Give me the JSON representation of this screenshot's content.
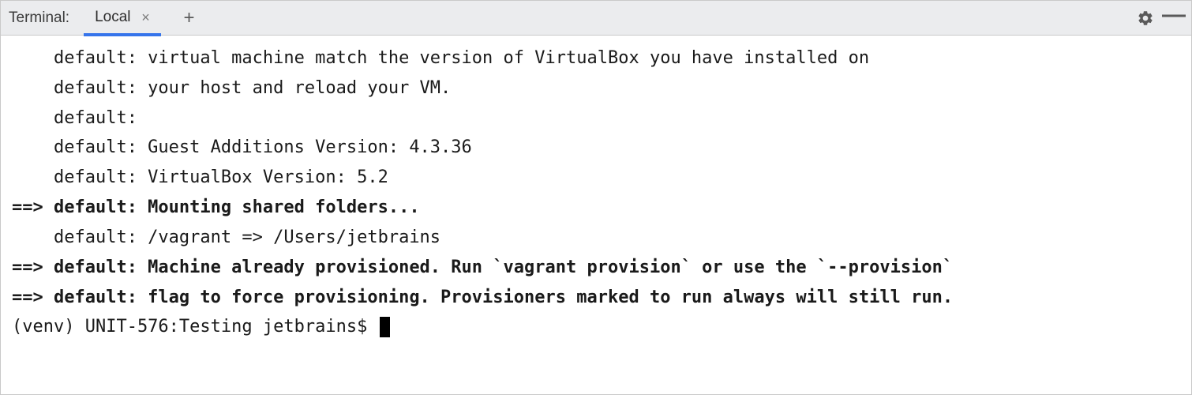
{
  "header": {
    "title": "Terminal:",
    "tab": {
      "label": "Local"
    }
  },
  "lines": [
    {
      "text": "    default: virtual machine match the version of VirtualBox you have installed on",
      "bold": false
    },
    {
      "text": "    default: your host and reload your VM.",
      "bold": false
    },
    {
      "text": "    default:",
      "bold": false
    },
    {
      "text": "    default: Guest Additions Version: 4.3.36",
      "bold": false
    },
    {
      "text": "    default: VirtualBox Version: 5.2",
      "bold": false
    },
    {
      "text": "==> default: Mounting shared folders...",
      "bold": true
    },
    {
      "text": "    default: /vagrant => /Users/jetbrains",
      "bold": false
    },
    {
      "text": "==> default: Machine already provisioned. Run `vagrant provision` or use the `--provision`",
      "bold": true
    },
    {
      "text": "==> default: flag to force provisioning. Provisioners marked to run always will still run.",
      "bold": true
    }
  ],
  "prompt": "(venv) UNIT-576:Testing jetbrains$ "
}
